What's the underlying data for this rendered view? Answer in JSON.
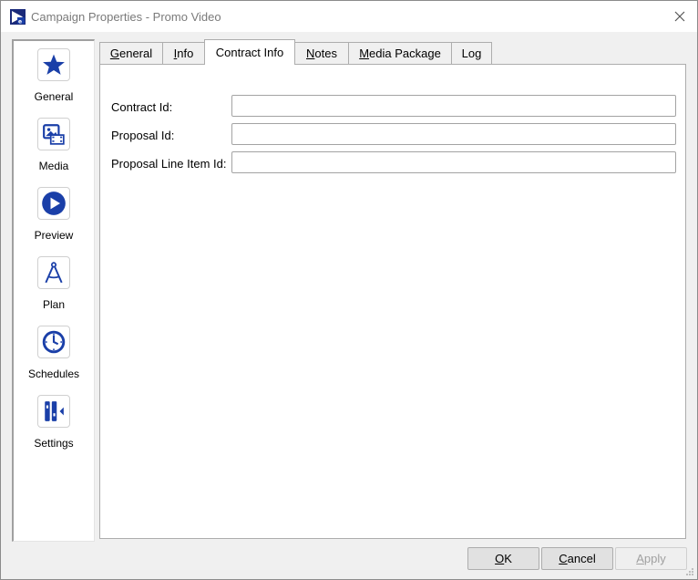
{
  "window": {
    "title": "Campaign Properties - Promo Video"
  },
  "sidebar": {
    "items": [
      {
        "label": "General",
        "icon": "star-icon"
      },
      {
        "label": "Media",
        "icon": "media-icon"
      },
      {
        "label": "Preview",
        "icon": "play-icon"
      },
      {
        "label": "Plan",
        "icon": "compass-icon"
      },
      {
        "label": "Schedules",
        "icon": "clock-icon"
      },
      {
        "label": "Settings",
        "icon": "settings-icon"
      }
    ]
  },
  "tabs": [
    {
      "label": "General",
      "mnemonic": "G",
      "rest": "eneral",
      "active": false
    },
    {
      "label": "Info",
      "mnemonic": "I",
      "rest": "nfo",
      "active": false
    },
    {
      "label": "Contract Info",
      "active": true
    },
    {
      "label": "Notes",
      "mnemonic": "N",
      "rest": "otes",
      "active": false
    },
    {
      "label": "Media Package",
      "mnemonic": "M",
      "rest": "edia Package",
      "active": false
    },
    {
      "label": "Log",
      "active": false
    }
  ],
  "form": {
    "contract_id_label": "Contract Id:",
    "contract_id_value": "",
    "proposal_id_label": "Proposal Id:",
    "proposal_id_value": "",
    "proposal_line_item_label": "Proposal Line Item Id:",
    "proposal_line_item_value": ""
  },
  "buttons": {
    "ok_mnemonic": "O",
    "ok_rest": "K",
    "cancel_mnemonic": "C",
    "cancel_rest": "ancel",
    "apply_mnemonic": "A",
    "apply_rest": "pply"
  },
  "colors": {
    "accent_blue": "#1a3fa8",
    "panel_border": "#adadad"
  }
}
